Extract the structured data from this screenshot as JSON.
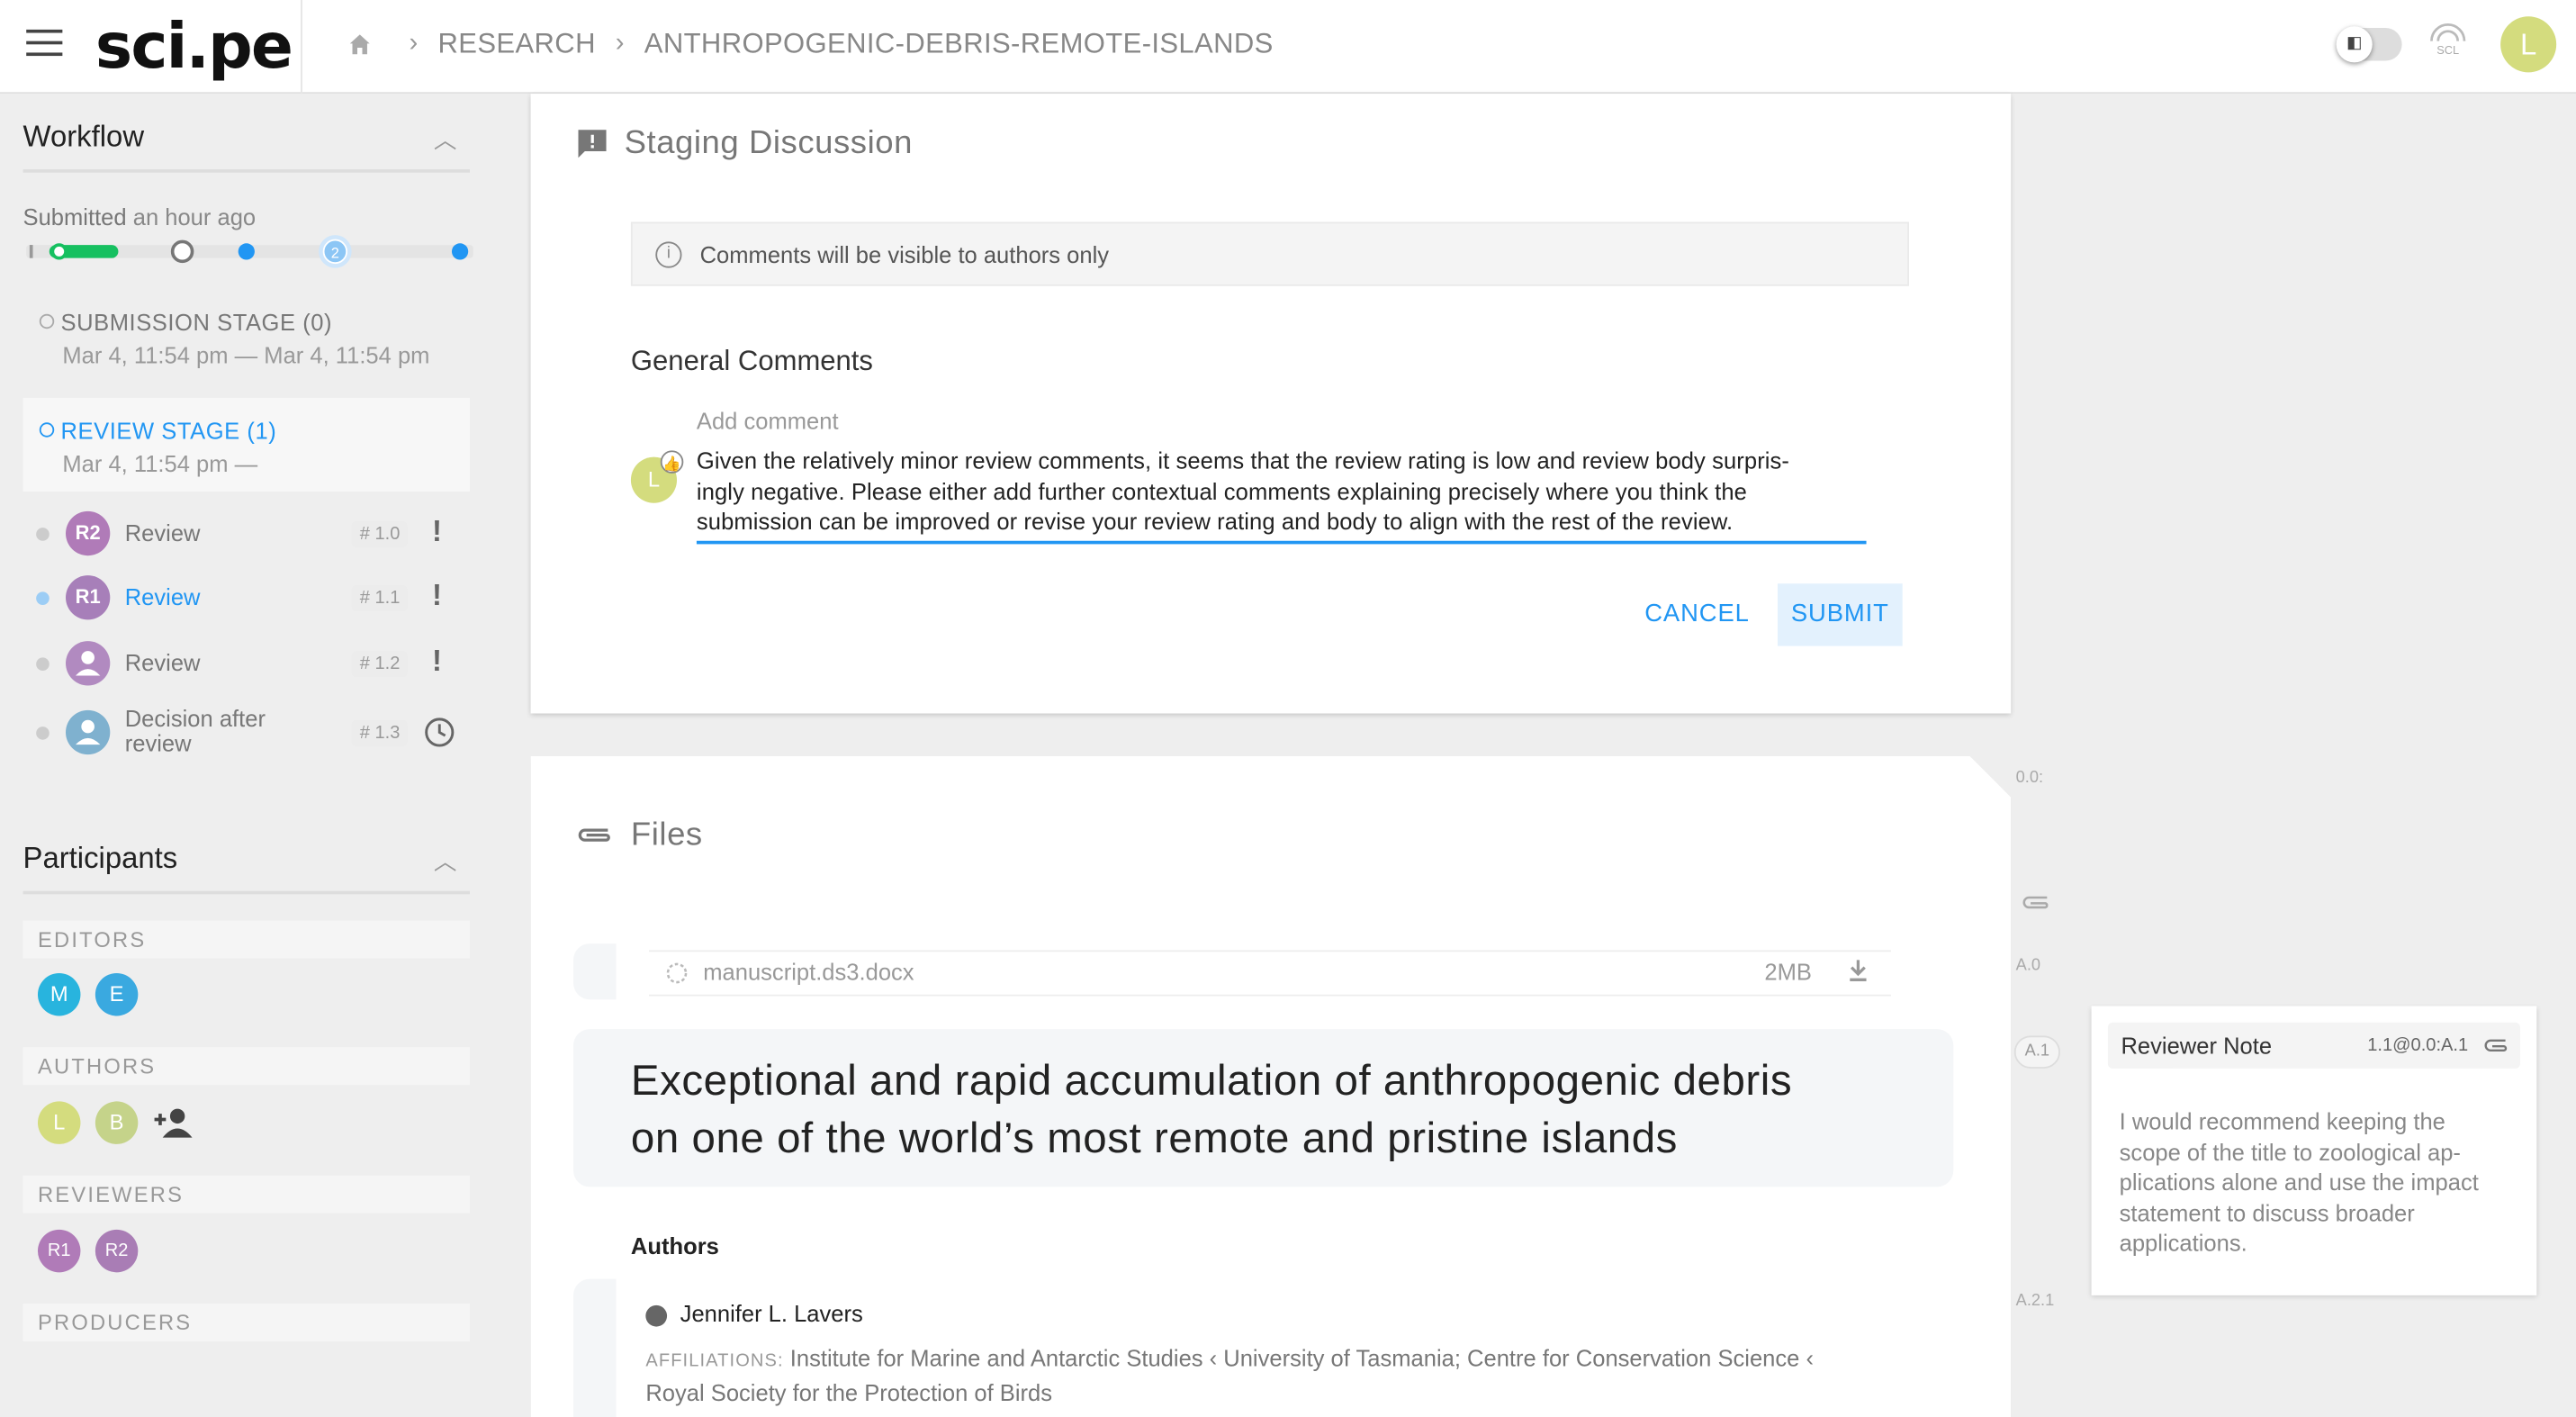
{
  "header": {
    "logo": "sci.pe",
    "breadcrumbs": [
      "RESEARCH",
      "ANTHROPOGENIC-DEBRIS-REMOTE-ISLANDS"
    ],
    "scl_label": "SCL",
    "user_initial": "L",
    "toggle_glyph": "◧"
  },
  "sidebar": {
    "workflow_title": "Workflow",
    "submitted_label": "Submitted",
    "submitted_time": "an hour ago",
    "progress_step": "2",
    "submission_stage": {
      "label": "SUBMISSION STAGE (0)",
      "dates": "Mar 4, 11:54 pm — Mar 4, 11:54 pm"
    },
    "review_stage": {
      "label": "REVIEW STAGE (1)",
      "dates": "Mar 4, 11:54 pm —"
    },
    "reviews": [
      {
        "avatar": "R2",
        "label": "Review",
        "num": "# 1.0",
        "mark": "!",
        "color": "#b07bb8",
        "active": false
      },
      {
        "avatar": "R1",
        "label": "Review",
        "num": "# 1.1",
        "mark": "!",
        "color": "#a77fb9",
        "active": true
      },
      {
        "avatar": "",
        "label": "Review",
        "num": "# 1.2",
        "mark": "!",
        "color": "#b18ac0",
        "active": false
      },
      {
        "avatar": "",
        "label": "Decision after review",
        "num": "# 1.3",
        "mark": "clock",
        "color": "#7fb1cf",
        "active": false
      }
    ],
    "participants_title": "Participants",
    "groups": {
      "editors": "EDITORS",
      "authors": "AUTHORS",
      "reviewers": "REVIEWERS",
      "producers": "PRODUCERS"
    },
    "editors": [
      {
        "initial": "M",
        "color": "#28b4de"
      },
      {
        "initial": "E",
        "color": "#3aa9e0"
      }
    ],
    "authors": [
      {
        "initial": "L",
        "color": "#d4dc7e"
      },
      {
        "initial": "B",
        "color": "#c5d38a"
      }
    ],
    "reviewers": [
      {
        "initial": "R1",
        "color": "#b07bb8"
      },
      {
        "initial": "R2",
        "color": "#a97db5"
      }
    ]
  },
  "discussion": {
    "title": "Staging Discussion",
    "info": "Comments will be visible to authors only",
    "general_comments": "General Comments",
    "add_comment_label": "Add comment",
    "commenter_initial": "L",
    "comment_lines": [
      "Given the relatively minor review comments, it seems that the review rating is low and review body surpris-",
      "ingly negative. Please either add further contextual comments explaining precisely where you think the",
      "submission can be improved or revise your review rating and body to align with the rest of the review."
    ],
    "cancel": "CANCEL",
    "submit": "SUBMIT"
  },
  "files": {
    "title": "Files",
    "file_name": "manuscript.ds3.docx",
    "file_size": "2MB",
    "doc_title_lines": [
      "Exceptional and rapid accumulation of anthropogenic debris",
      "on one of the world’s most remote and pristine islands"
    ],
    "authors_label": "Authors",
    "author_name": "Jennifer L. Lavers",
    "affiliations_label": "AFFILIATIONS:",
    "affiliations_lines": [
      "Institute for Marine and Antarctic Studies ‹ University of Tasmania; Centre for Conservation Science ‹",
      "Royal Society for the Protection of Birds"
    ]
  },
  "annotations": {
    "anchors": [
      "0.0:",
      "A.0",
      "A.1",
      "A.2.1"
    ],
    "note_title": "Reviewer Note",
    "note_id": "1.1@0.0:A.1",
    "note_lines": [
      "I would recommend keeping the",
      "scope of the title to zoological ap-",
      "plications alone and use the impact",
      "statement to discuss broader",
      "applications."
    ]
  },
  "colors": {
    "accent": "#2196f3",
    "success": "#16c060"
  }
}
